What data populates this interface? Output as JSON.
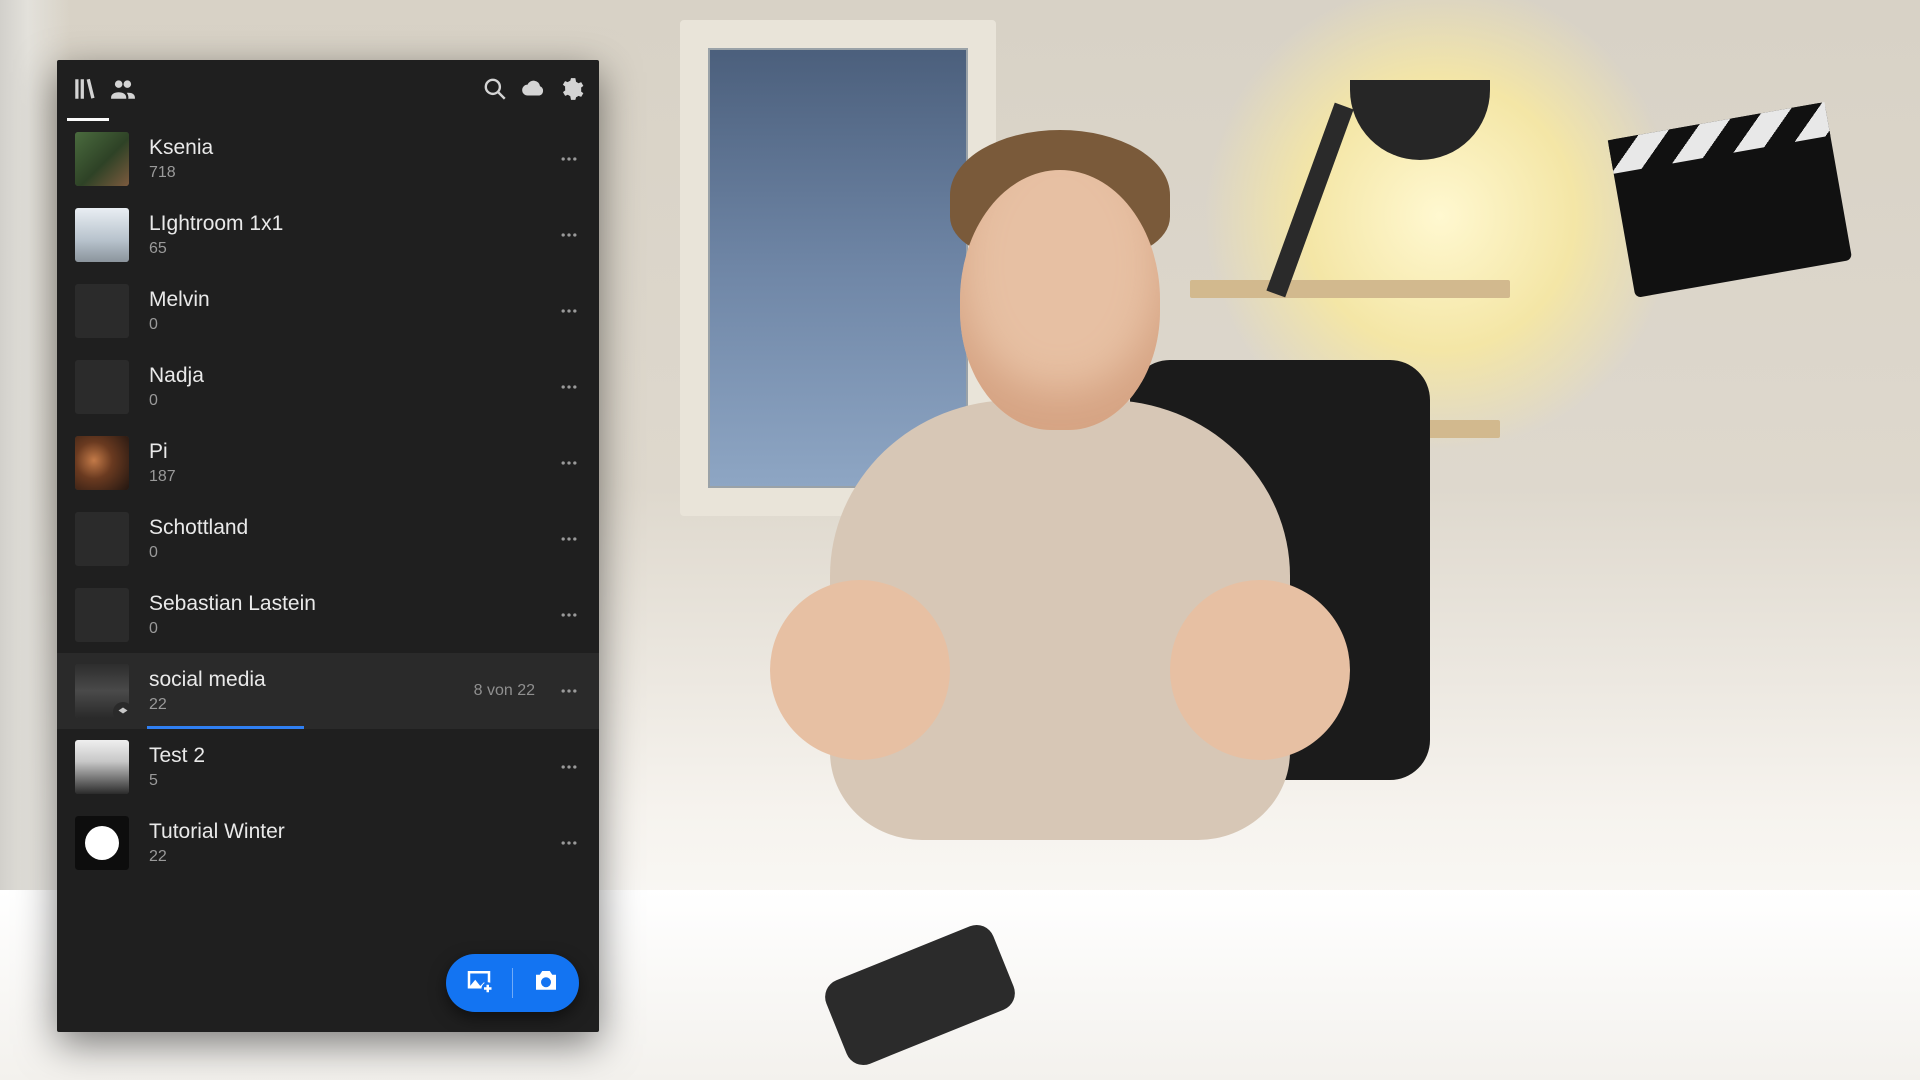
{
  "albums": [
    {
      "name": "Ksenia",
      "count": "718",
      "thumb": "ksenia"
    },
    {
      "name": "LIghtroom 1x1",
      "count": "65",
      "thumb": "lr"
    },
    {
      "name": "Melvin",
      "count": "0",
      "thumb": ""
    },
    {
      "name": "Nadja",
      "count": "0",
      "thumb": ""
    },
    {
      "name": "Pi",
      "count": "187",
      "thumb": "pi"
    },
    {
      "name": "Schottland",
      "count": "0",
      "thumb": ""
    },
    {
      "name": "Sebastian Lastein",
      "count": "0",
      "thumb": ""
    },
    {
      "name": "social media",
      "count": "22",
      "thumb": "social",
      "selected": true,
      "badge": true,
      "status": "8 von 22",
      "progress": 36
    },
    {
      "name": "Test 2",
      "count": "5",
      "thumb": "test2"
    },
    {
      "name": "Tutorial Winter",
      "count": "22",
      "thumb": "tutwinter"
    }
  ]
}
